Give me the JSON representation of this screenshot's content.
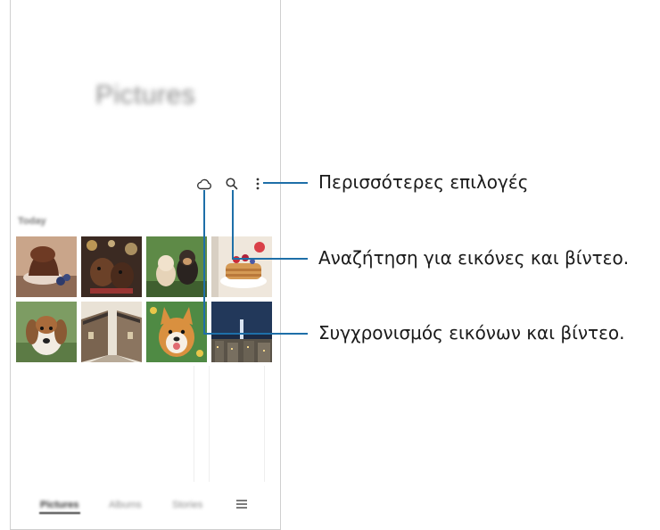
{
  "screen": {
    "title": "Pictures",
    "section_label": "Today",
    "toolbar": {
      "icons": [
        "cloud-sync-icon",
        "search-icon",
        "more-options-icon"
      ]
    },
    "thumbnails": [
      {
        "subject": "chocolate-muffin",
        "color": "#7a4a33"
      },
      {
        "subject": "dogs-with-lights",
        "color": "#5b3b2c"
      },
      {
        "subject": "puppy-and-kitten",
        "color": "#4f7a3f"
      },
      {
        "subject": "pancakes",
        "color": "#d7b38c"
      },
      {
        "subject": "beagle-puppy",
        "color": "#6f8a55"
      },
      {
        "subject": "village-street",
        "color": "#a89278"
      },
      {
        "subject": "corgi",
        "color": "#5f8f52"
      },
      {
        "subject": "city-night",
        "color": "#243650"
      }
    ],
    "bottom_nav": {
      "tabs": [
        "Pictures",
        "Albums",
        "Stories"
      ],
      "active_tab": "Pictures",
      "menu_icon": "menu-icon"
    }
  },
  "callouts": {
    "more_options": "Περισσότερες επιλογές",
    "search": "Αναζήτηση για εικόνες και βίντεο.",
    "sync": "Συγχρονισμός εικόνων και βίντεο."
  },
  "colors": {
    "leader_line": "#1e6fa8",
    "frame": "#cfcfcf"
  }
}
